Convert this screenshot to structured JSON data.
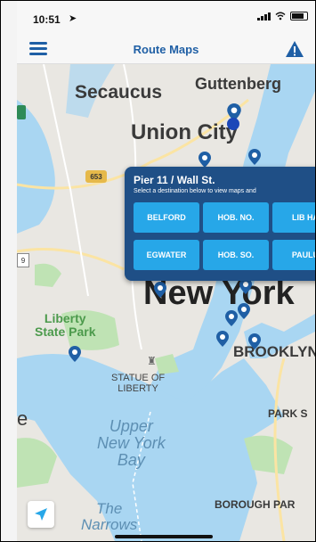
{
  "status_bar": {
    "time": "10:51",
    "location_arrow": "location-arrow-icon"
  },
  "nav": {
    "title": "Route Maps",
    "menu_icon": "menu-icon",
    "alert_icon": "warning-icon"
  },
  "map": {
    "labels": {
      "secaucus": "Secaucus",
      "guttenberg": "Guttenberg",
      "union_city": "Union City",
      "new_york": "New York",
      "liberty_state_park_1": "Liberty",
      "liberty_state_park_2": "State Park",
      "statue_1": "STATUE OF",
      "statue_2": "LIBERTY",
      "brooklyn": "BROOKLYN",
      "park_slope": "PARK S",
      "upper_bay_1": "Upper",
      "upper_bay_2": "New York",
      "upper_bay_3": "Bay",
      "borough_park": "BOROUGH PAR",
      "narrows_1": "The",
      "narrows_2": "Narrows",
      "route_653": "653",
      "edge_e": "e",
      "edge_9": "9"
    },
    "colors": {
      "water": "#a9d6f2",
      "land": "#e9e7e2",
      "park": "#bfe3b4",
      "pin": "#1f5fa5"
    }
  },
  "popup": {
    "title": "Pier 11 / Wall St.",
    "subtitle": "Select a destination below to view maps and",
    "destinations": [
      "BELFORD",
      "HOB. NO.",
      "LIB HA",
      "EGWATER",
      "HOB. SO.",
      "PAULU"
    ]
  }
}
